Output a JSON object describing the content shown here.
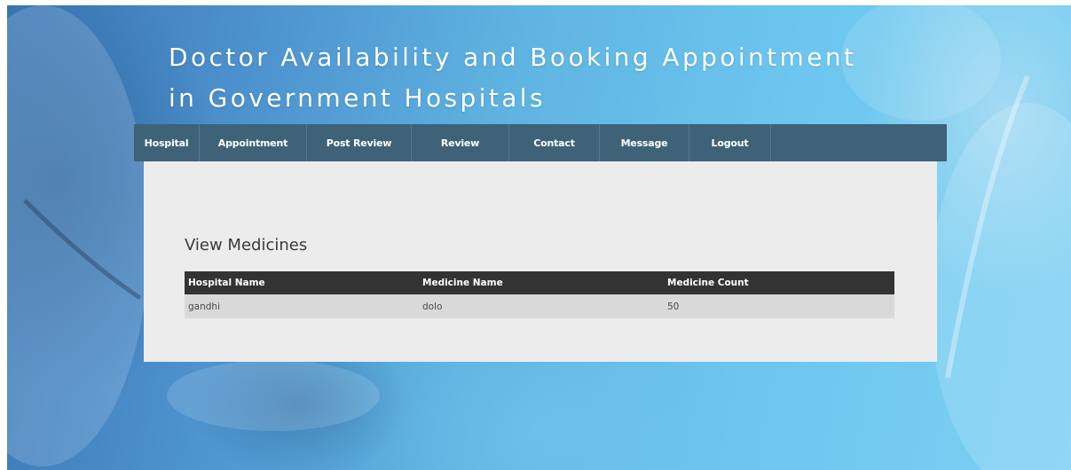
{
  "site": {
    "title_line1": "Doctor Availability and Booking Appointment",
    "title_line2": "in Government Hospitals"
  },
  "nav": {
    "items": [
      {
        "label": "Hospital"
      },
      {
        "label": "Appointment"
      },
      {
        "label": "Post Review"
      },
      {
        "label": "Review"
      },
      {
        "label": "Contact"
      },
      {
        "label": "Message"
      },
      {
        "label": "Logout"
      }
    ]
  },
  "main": {
    "heading": "View Medicines",
    "table": {
      "headers": [
        "Hospital Name",
        "Medicine Name",
        "Medicine Count"
      ],
      "rows": [
        [
          "gandhi",
          "dolo",
          "50"
        ]
      ]
    }
  },
  "colors": {
    "nav_bg": "#3e6277",
    "panel_bg": "#ececec",
    "table_header_bg": "#333333",
    "table_row_bg": "#d9d9d9"
  }
}
